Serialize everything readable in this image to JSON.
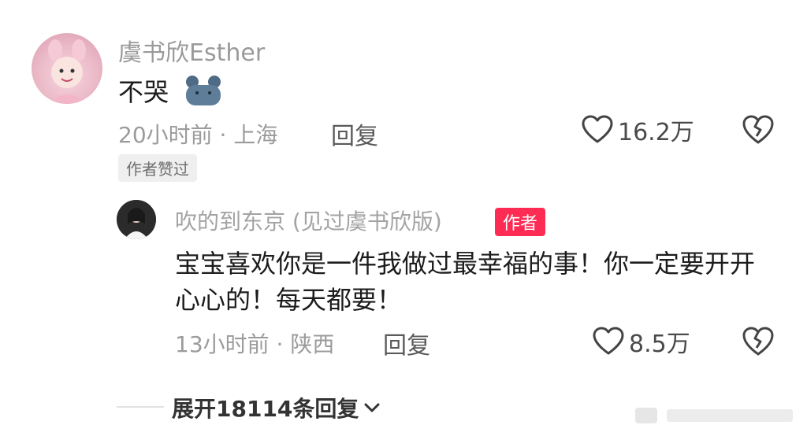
{
  "comment": {
    "author": "虞书欣Esther",
    "text": "不哭",
    "time_location": "20小时前 · 上海",
    "reply_label": "回复",
    "likes": "16.2万",
    "liked_by_author_badge": "作者赞过"
  },
  "reply": {
    "author": "吹的到东京 (见过虞书欣版)",
    "author_tag": "作者",
    "text": "宝宝喜欢你是一件我做过最幸福的事！你一定要开开心心的！每天都要！",
    "time_location": "13小时前 · 陕西",
    "reply_label": "回复",
    "likes": "8.5万"
  },
  "expand": {
    "label": "展开18114条回复"
  },
  "icons": {
    "like": "heart-outline-icon",
    "dislike": "broken-heart-icon",
    "expand": "chevron-down-icon",
    "emoji": "bear-emoji-icon"
  },
  "colors": {
    "author_tag_bg": "#fe2c55",
    "muted_text": "#9b9b9b",
    "badge_bg": "#efefef"
  }
}
